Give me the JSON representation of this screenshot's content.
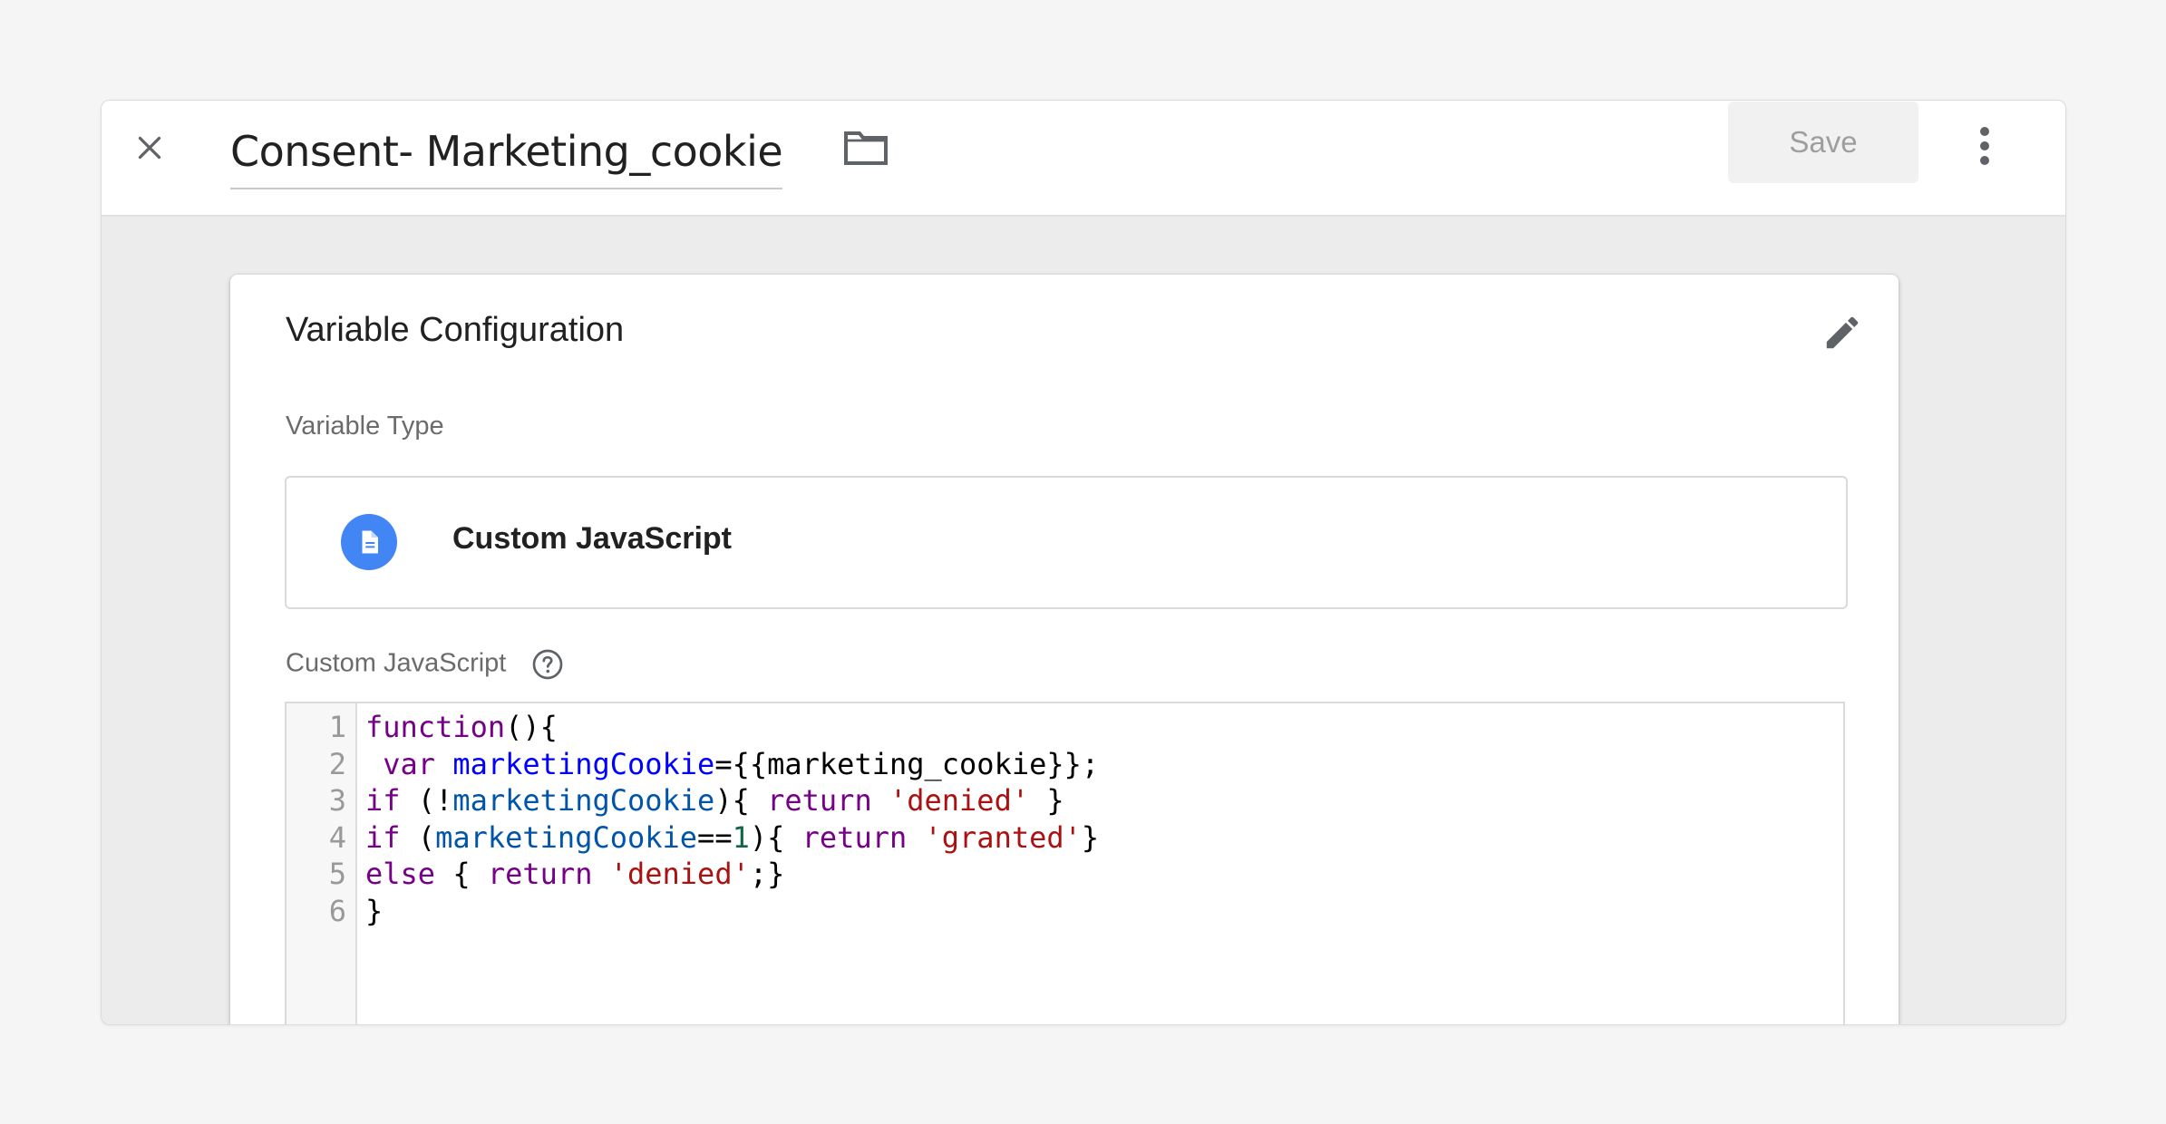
{
  "header": {
    "title": "Consent- Marketing_cookie",
    "save_label": "Save"
  },
  "config": {
    "heading": "Variable Configuration",
    "type_label": "Variable Type",
    "type_name": "Custom JavaScript",
    "code_label": "Custom JavaScript"
  },
  "code": {
    "line_numbers": [
      "1",
      "2",
      "3",
      "4",
      "5",
      "6"
    ],
    "lines": [
      [
        {
          "t": "function",
          "c": "kw"
        },
        {
          "t": "(){",
          "c": ""
        }
      ],
      [
        {
          "t": " ",
          "c": ""
        },
        {
          "t": "var",
          "c": "kw"
        },
        {
          "t": " ",
          "c": ""
        },
        {
          "t": "marketingCookie",
          "c": "def"
        },
        {
          "t": "={{marketing_cookie}};",
          "c": ""
        }
      ],
      [
        {
          "t": "if",
          "c": "kw"
        },
        {
          "t": " (!",
          "c": ""
        },
        {
          "t": "marketingCookie",
          "c": "vr"
        },
        {
          "t": "){ ",
          "c": ""
        },
        {
          "t": "return",
          "c": "kw"
        },
        {
          "t": " ",
          "c": ""
        },
        {
          "t": "'denied'",
          "c": "str"
        },
        {
          "t": " }",
          "c": ""
        }
      ],
      [
        {
          "t": "if",
          "c": "kw"
        },
        {
          "t": " (",
          "c": ""
        },
        {
          "t": "marketingCookie",
          "c": "vr"
        },
        {
          "t": "==",
          "c": ""
        },
        {
          "t": "1",
          "c": "num"
        },
        {
          "t": "){ ",
          "c": ""
        },
        {
          "t": "return",
          "c": "kw"
        },
        {
          "t": " ",
          "c": ""
        },
        {
          "t": "'granted'",
          "c": "str"
        },
        {
          "t": "}",
          "c": ""
        }
      ],
      [
        {
          "t": "else",
          "c": "kw"
        },
        {
          "t": " { ",
          "c": ""
        },
        {
          "t": "return",
          "c": "kw"
        },
        {
          "t": " ",
          "c": ""
        },
        {
          "t": "'denied'",
          "c": "str"
        },
        {
          "t": ";}",
          "c": ""
        }
      ],
      [
        {
          "t": "}",
          "c": ""
        }
      ]
    ]
  },
  "icons": {
    "close": "close-icon",
    "folder": "folder-icon",
    "more": "more-vert-icon",
    "edit": "pencil-icon",
    "type": "document-icon",
    "help": "help-icon"
  },
  "colors": {
    "accent": "#4285f4",
    "keyword": "#770088",
    "variable": "#0055aa",
    "string": "#aa1111",
    "number": "#116644"
  }
}
